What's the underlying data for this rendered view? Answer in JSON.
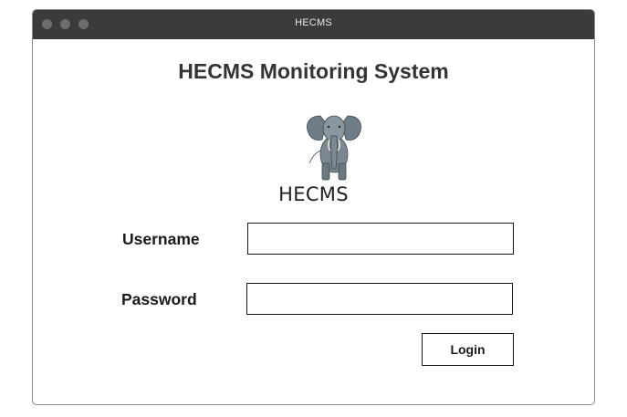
{
  "window": {
    "title": "HECMS"
  },
  "app": {
    "title": "HECMS Monitoring System",
    "logo_text": "HECMS",
    "logo_icon": "elephant-icon"
  },
  "form": {
    "username_label": "Username",
    "username_value": "",
    "password_label": "Password",
    "password_value": "",
    "login_label": "Login"
  },
  "colors": {
    "titlebar": "#3b3b3b",
    "text": "#1a1a1a"
  }
}
